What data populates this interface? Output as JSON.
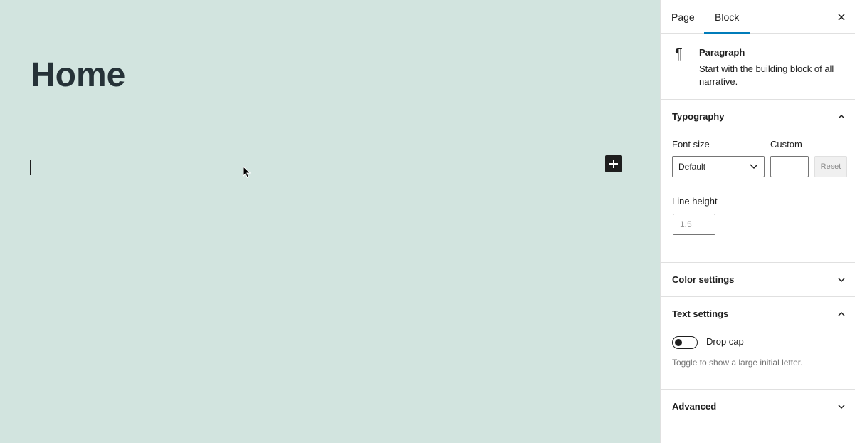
{
  "editor": {
    "title": "Home",
    "canvas_color": "#d2e4df",
    "inserter_icon": "plus-icon"
  },
  "sidebar": {
    "tabs": [
      {
        "label": "Page",
        "active": false
      },
      {
        "label": "Block",
        "active": true
      }
    ],
    "close_icon": "close-icon",
    "block_card": {
      "icon": "paragraph-icon",
      "title": "Paragraph",
      "description": "Start with the building block of all narrative."
    },
    "typography": {
      "title": "Typography",
      "expanded": true,
      "font_size_label": "Font size",
      "font_size_value": "Default",
      "custom_label": "Custom",
      "custom_value": "",
      "reset_label": "Reset",
      "line_height_label": "Line height",
      "line_height_placeholder": "1.5"
    },
    "color_settings": {
      "title": "Color settings",
      "expanded": false
    },
    "text_settings": {
      "title": "Text settings",
      "expanded": true,
      "drop_cap_label": "Drop cap",
      "drop_cap_enabled": false,
      "drop_cap_help": "Toggle to show a large initial letter."
    },
    "advanced": {
      "title": "Advanced",
      "expanded": false
    }
  },
  "colors": {
    "accent": "#007cba",
    "text": "#1e1e1e",
    "title": "#263238",
    "border": "#e0e0e0"
  }
}
